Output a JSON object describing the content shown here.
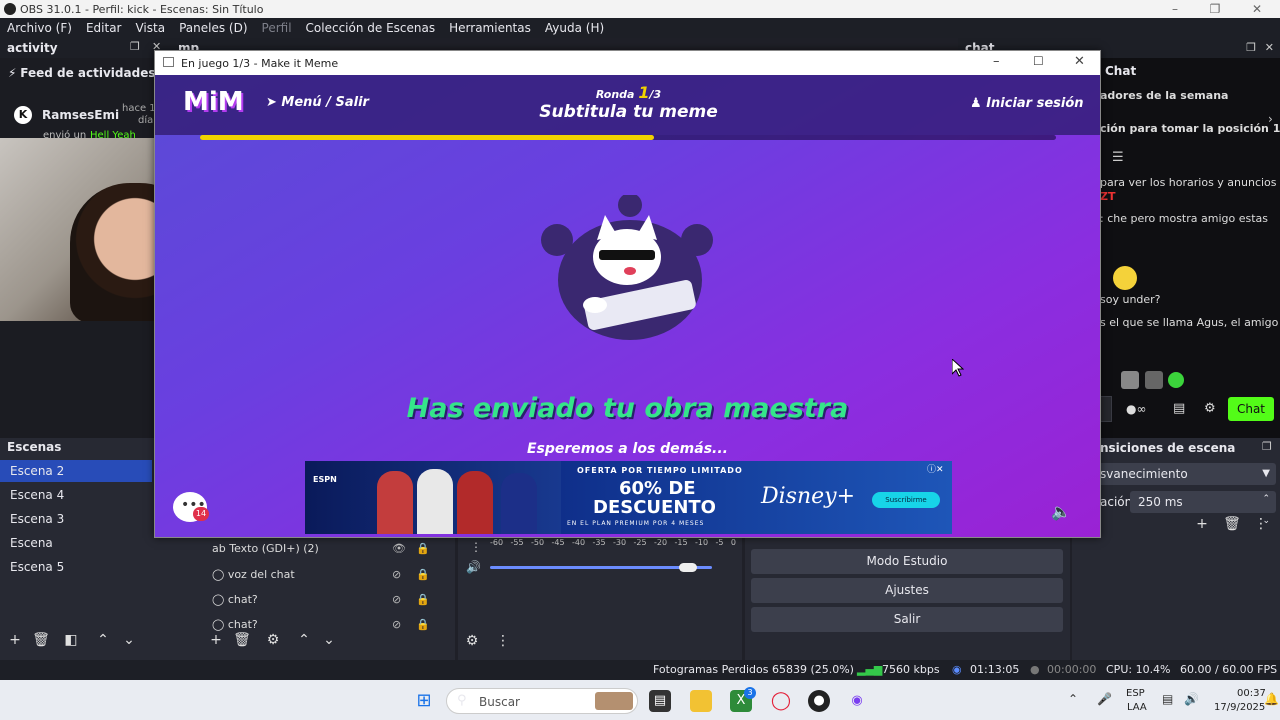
{
  "obs": {
    "title": "OBS 31.0.1 - Perfil: kick - Escenas: Sin Título",
    "menu": [
      "Archivo (F)",
      "Editar",
      "Vista",
      "Paneles (D)",
      "Perfil",
      "Colección de Escenas",
      "Herramientas",
      "Ayuda (H)"
    ]
  },
  "activity": {
    "dock_title": "activity",
    "second_dock_title": "mp",
    "feed_title": "Feed de actividades",
    "user": "RamsesEmi",
    "time": "hace 1",
    "time2": "día",
    "action": "envió un",
    "gift": "Hell Yeah"
  },
  "chat": {
    "dock_title": "chat",
    "header": "Chat",
    "lines": [
      "adores de la semana",
      "ción para tomar la posición 1",
      "para ver los horarios y anuncios",
      "ZT",
      ": che pero mostra amigo estas",
      "soy under?",
      "s el que se llama Agus, el amigo"
    ],
    "send_label": "Chat"
  },
  "scenes": {
    "title": "Escenas",
    "items": [
      "Escena 2",
      "Escena 4",
      "Escena 3",
      "Escena",
      "Escena 5"
    ],
    "selected": 0
  },
  "sources": {
    "items": [
      "Texto (GDI+) (2)",
      "voz del chat",
      "chat?",
      "chat?"
    ]
  },
  "mixer": {
    "scale": [
      "-60",
      "-55",
      "-50",
      "-45",
      "-40",
      "-35",
      "-30",
      "-25",
      "-20",
      "-15",
      "-10",
      "-5",
      "0"
    ],
    "volume": 0.89
  },
  "controls": {
    "buttons": [
      "Modo Estudio",
      "Ajustes",
      "Salir"
    ]
  },
  "transitions": {
    "title": "nsiciones de escena",
    "type": "svanecimiento",
    "duration_label": "ación",
    "duration": "250 ms"
  },
  "status": {
    "dropped": "Fotogramas Perdidos 65839 (25.0%)",
    "bitrate": "7560 kbps",
    "stream_time": "01:13:05",
    "rec_time": "00:00:00",
    "cpu": "CPU: 10.4%",
    "fps": "60.00 / 60.00 FPS"
  },
  "taskbar": {
    "search_placeholder": "Buscar",
    "lang": "ESP",
    "lang2": "LAA",
    "time": "00:37",
    "date": "17/9/2025",
    "badge": "3"
  },
  "game": {
    "window_title": "En juego 1/3 - Make it Meme",
    "logo": "MiM",
    "menu": "Menú / Salir",
    "round_label": "Ronda",
    "round_current": "1",
    "round_total": "/3",
    "stage": "Subtitula tu meme",
    "login": "Iniciar sesión",
    "progress": 0.53,
    "sent_title": "Has enviado tu obra maestra",
    "wait_text": "Esperemos a los demás...",
    "chat_badge": "14",
    "ad": {
      "brand": "ESPN",
      "offer": "OFERTA POR TIEMPO LIMITADO",
      "discount": "60% DE",
      "discount2": "DESCUENTO",
      "plan": "EN EL PLAN PREMIUM POR 4 MESES",
      "service": "Disney+",
      "cta": "Suscríbirme"
    }
  },
  "colors": {
    "accent_green": "#35e58a",
    "progress_yellow": "#f1d200",
    "chat_button": "#53fc18",
    "scene_selected": "#284cb8"
  }
}
